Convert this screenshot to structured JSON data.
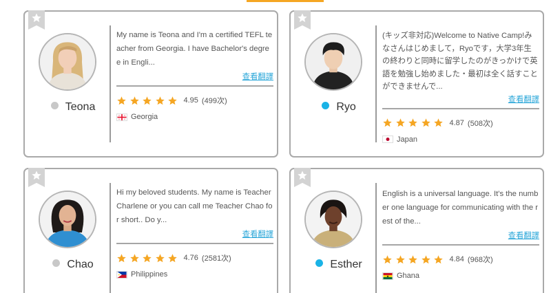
{
  "theme": {
    "accent": "#f5a623",
    "link_color": "#2ba7d9",
    "star_color": "#f5a623",
    "online_color": "#1ab3e6",
    "offline_color": "#c8c8c8"
  },
  "teachers": [
    {
      "name": "Teona",
      "status": "offline",
      "intro": "My name is Teona and I'm a certified TEFL teacher from Georgia. I have Bachelor's degree in Engli...",
      "translate_label": "查看翻譯",
      "rating": "4.95",
      "reviews": "(499次)",
      "country": "Georgia",
      "flag_icon": "georgia-flag-icon"
    },
    {
      "name": "Ryo",
      "status": "online",
      "intro": "(キッズ非対応)Welcome to Native Camp!みなさんはじめまして，Ryoです，大学3年生の終わりと同時に留学したのがきっかけで英語を勉強し始めました・最初は全く話すことができませんで...",
      "translate_label": "查看翻譯",
      "rating": "4.87",
      "reviews": "(508次)",
      "country": "Japan",
      "flag_icon": "japan-flag-icon"
    },
    {
      "name": "Chao",
      "status": "offline",
      "intro": "Hi my beloved students. My name is Teacher Charlene or you can call me Teacher Chao for short.. Do y...",
      "translate_label": "查看翻譯",
      "rating": "4.76",
      "reviews": "(2581次)",
      "country": "Philippines",
      "flag_icon": "philippines-flag-icon"
    },
    {
      "name": "Esther",
      "status": "online",
      "intro": "English is a universal language. It's the number one language for communicating with the rest of the...",
      "translate_label": "查看翻譯",
      "rating": "4.84",
      "reviews": "(968次)",
      "country": "Ghana",
      "flag_icon": "ghana-flag-icon"
    }
  ]
}
